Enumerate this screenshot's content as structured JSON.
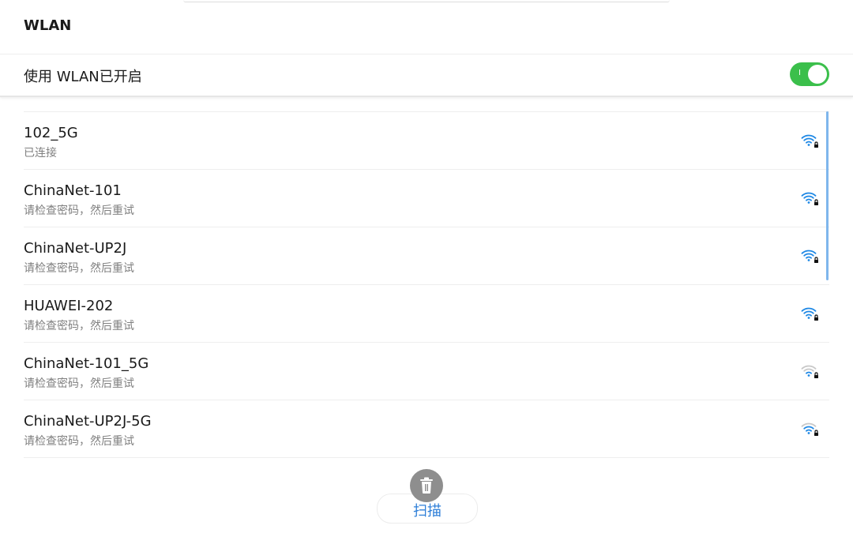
{
  "header": {
    "title": "WLAN"
  },
  "wlan_toggle": {
    "label": "使用 WLAN已开启",
    "state": "on",
    "on_mark": "I",
    "on_color": "#3bbf4b"
  },
  "networks": [
    {
      "name": "102_5G",
      "status": "已连接",
      "signal_icon": "wifi-lock-icon",
      "signal_strength": "full"
    },
    {
      "name": "ChinaNet-101",
      "status": "请检查密码，然后重试",
      "signal_icon": "wifi-lock-icon",
      "signal_strength": "full"
    },
    {
      "name": "ChinaNet-UP2J",
      "status": "请检查密码，然后重试",
      "signal_icon": "wifi-lock-icon",
      "signal_strength": "full"
    },
    {
      "name": "HUAWEI-202",
      "status": "请检查密码，然后重试",
      "signal_icon": "wifi-lock-icon",
      "signal_strength": "full"
    },
    {
      "name": "ChinaNet-101_5G",
      "status": "请检查密码，然后重试",
      "signal_icon": "wifi-lock-icon",
      "signal_strength": "weak"
    },
    {
      "name": "ChinaNet-UP2J-5G",
      "status": "请检查密码，然后重试",
      "signal_icon": "wifi-lock-icon",
      "signal_strength": "medium"
    }
  ],
  "scan": {
    "label": "扫描",
    "icon": "trash-icon"
  },
  "colors": {
    "accent": "#2f7fd8",
    "wifi": "#1e88e5",
    "wifi_dim": "#c8c8c8"
  }
}
